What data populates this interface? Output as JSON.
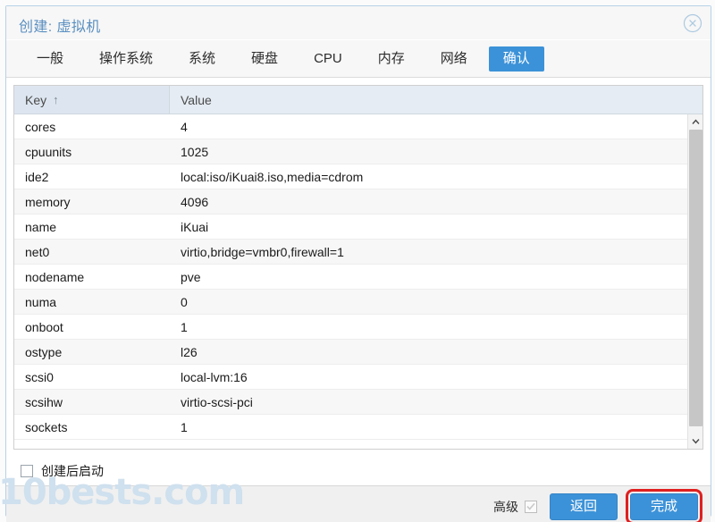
{
  "window": {
    "title": "创建: 虚拟机",
    "close_icon": "close-circle-icon"
  },
  "tabs": [
    {
      "label": "一般",
      "active": false
    },
    {
      "label": "操作系统",
      "active": false
    },
    {
      "label": "系统",
      "active": false
    },
    {
      "label": "硬盘",
      "active": false
    },
    {
      "label": "CPU",
      "active": false
    },
    {
      "label": "内存",
      "active": false
    },
    {
      "label": "网络",
      "active": false
    },
    {
      "label": "确认",
      "active": true
    }
  ],
  "grid": {
    "columns": [
      {
        "key": "key",
        "label": "Key",
        "sorted": true,
        "sort_arrow": "↑"
      },
      {
        "key": "value",
        "label": "Value",
        "sorted": false,
        "sort_arrow": ""
      }
    ],
    "rows": [
      {
        "key": "cores",
        "value": "4"
      },
      {
        "key": "cpuunits",
        "value": "1025"
      },
      {
        "key": "ide2",
        "value": "local:iso/iKuai8.iso,media=cdrom"
      },
      {
        "key": "memory",
        "value": "4096"
      },
      {
        "key": "name",
        "value": "iKuai"
      },
      {
        "key": "net0",
        "value": "virtio,bridge=vmbr0,firewall=1"
      },
      {
        "key": "nodename",
        "value": "pve"
      },
      {
        "key": "numa",
        "value": "0"
      },
      {
        "key": "onboot",
        "value": "1"
      },
      {
        "key": "ostype",
        "value": "l26"
      },
      {
        "key": "scsi0",
        "value": "local-lvm:16"
      },
      {
        "key": "scsihw",
        "value": "virtio-scsi-pci"
      },
      {
        "key": "sockets",
        "value": "1"
      }
    ],
    "scrollbar": {
      "up_icon": "chevron-up-icon",
      "down_icon": "chevron-down-icon"
    }
  },
  "options": {
    "start_after_create": {
      "label": "创建后启动",
      "checked": false
    }
  },
  "footer": {
    "advanced": {
      "label": "高级",
      "checked": true
    },
    "back_button": "返回",
    "finish_button": "完成",
    "highlight_color": "#e02020"
  },
  "watermark": {
    "text": "10bests.com"
  },
  "colors": {
    "accent": "#3c92d8",
    "title": "#5a8fc0",
    "header_bg": "#e5ecf3",
    "footer_bg": "#f0f0f0"
  }
}
